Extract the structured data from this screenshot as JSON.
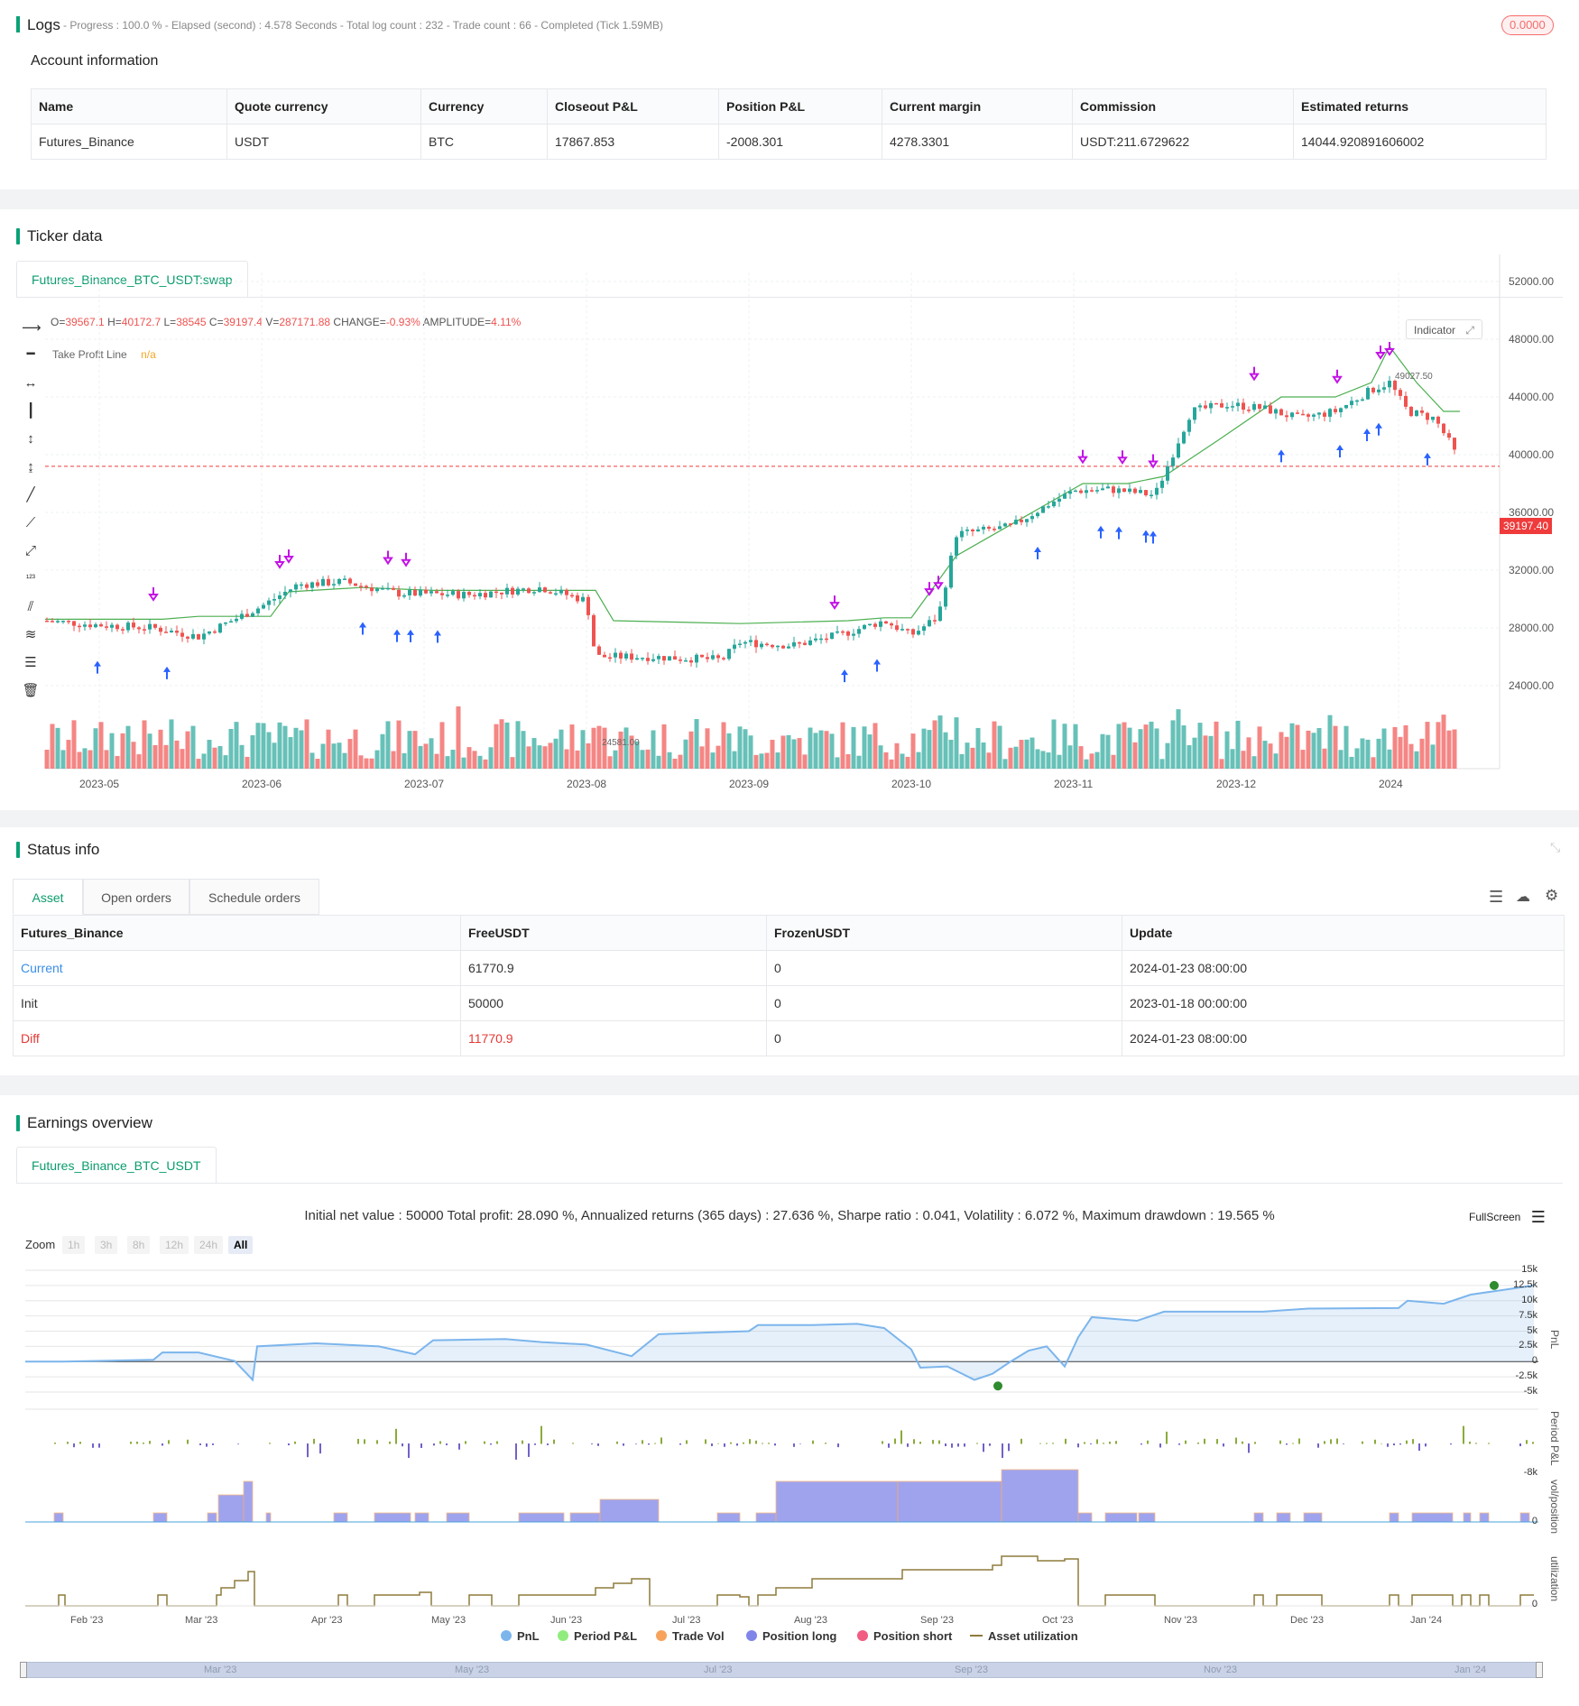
{
  "logs": {
    "title": "Logs",
    "status_text": "- Progress : 100.0 % - Elapsed (second) : 4.578  Seconds - Total log count : 232 - Trade count : 66 - Completed (Tick 1.59MB)",
    "badge": "0.0000"
  },
  "account": {
    "title": "Account information",
    "columns": [
      "Name",
      "Quote currency",
      "Currency",
      "Closeout P&L",
      "Position P&L",
      "Current margin",
      "Commission",
      "Estimated returns"
    ],
    "row": [
      "Futures_Binance",
      "USDT",
      "BTC",
      "17867.853",
      "-2008.301",
      "4278.3301",
      "USDT:211.6729622",
      "14044.920891606002"
    ]
  },
  "ticker": {
    "title": "Ticker data",
    "tab": "Futures_Binance_BTC_USDT:swap",
    "ohlc": {
      "o_label": "O=",
      "o": "39567.1",
      "h_label": "H=",
      "h": "40172.7",
      "l_label": "L=",
      "l": "38545",
      "c_label": "C=",
      "c": "39197.4",
      "v_label": "V=",
      "v": "287171.88",
      "change_label": "CHANGE=",
      "change": "-0.93%",
      "amp_label": "AMPLITUDE=",
      "amp": "4.11%"
    },
    "indicator_name": "Take Profit Line",
    "indicator_value": "n/a",
    "indicator_button": "Indicator",
    "price_tag": "39197.40",
    "high_label": "49027.50",
    "low_label": "24581.00",
    "y_ticks": [
      "52000.00",
      "48000.00",
      "44000.00",
      "40000.00",
      "36000.00",
      "32000.00",
      "28000.00",
      "24000.00"
    ],
    "x_ticks": [
      "2023-05",
      "2023-06",
      "2023-07",
      "2023-08",
      "2023-09",
      "2023-10",
      "2023-11",
      "2023-12",
      "2024"
    ],
    "colors": {
      "up": "#26a69a",
      "down": "#ef5350",
      "line": "#4caf50",
      "marker_buy": "#2962ff",
      "marker_close": "#c313e6"
    }
  },
  "status": {
    "title": "Status info",
    "tabs": [
      "Asset",
      "Open orders",
      "Schedule orders"
    ],
    "columns": [
      "Futures_Binance",
      "FreeUSDT",
      "FrozenUSDT",
      "Update"
    ],
    "rows": [
      [
        "Current",
        "61770.9",
        "0",
        "2024-01-23 08:00:00"
      ],
      [
        "Init",
        "50000",
        "0",
        "2023-01-18 00:00:00"
      ],
      [
        "Diff",
        "11770.9",
        "0",
        "2024-01-23 08:00:00"
      ]
    ]
  },
  "earnings": {
    "title": "Earnings overview",
    "tab": "Futures_Binance_BTC_USDT",
    "summary": "Initial net value : 50000 Total profit: 28.090 %, Annualized returns (365 days) : 27.636 %, Sharpe ratio : 0.041, Volatility : 6.072 %, Maximum drawdown : 19.565 %",
    "fullscreen": "FullScreen",
    "zoom_label": "Zoom",
    "zoom_buttons": [
      "1h",
      "3h",
      "8h",
      "12h",
      "24h",
      "All"
    ],
    "pnl_ticks": [
      "15k",
      "12.5k",
      "10k",
      "7.5k",
      "5k",
      "2.5k",
      "0",
      "-2.5k",
      "-5k"
    ],
    "period_tick": "-8k",
    "vol_tick": "0",
    "util_tick": "0",
    "axis_titles": [
      "PnL",
      "Period P&L",
      "vol/position",
      "utilization"
    ],
    "x_ticks": [
      "Feb '23",
      "Mar '23",
      "Apr '23",
      "May '23",
      "Jun '23",
      "Jul '23",
      "Aug '23",
      "Sep '23",
      "Oct '23",
      "Nov '23",
      "Dec '23",
      "Jan '24"
    ],
    "nav_ticks": [
      "Mar '23",
      "May '23",
      "Jul '23",
      "Sep '23",
      "Nov '23",
      "Jan '24"
    ],
    "legend": [
      {
        "label": "PnL",
        "color": "#7cb5ec"
      },
      {
        "label": "Period P&L",
        "color": "#90ed7d"
      },
      {
        "label": "Trade Vol",
        "color": "#f7a35c"
      },
      {
        "label": "Position long",
        "color": "#8085e9"
      },
      {
        "label": "Position short",
        "color": "#f15c80"
      },
      {
        "label": "Asset utilization",
        "color": "#8d7b3b"
      }
    ]
  }
}
